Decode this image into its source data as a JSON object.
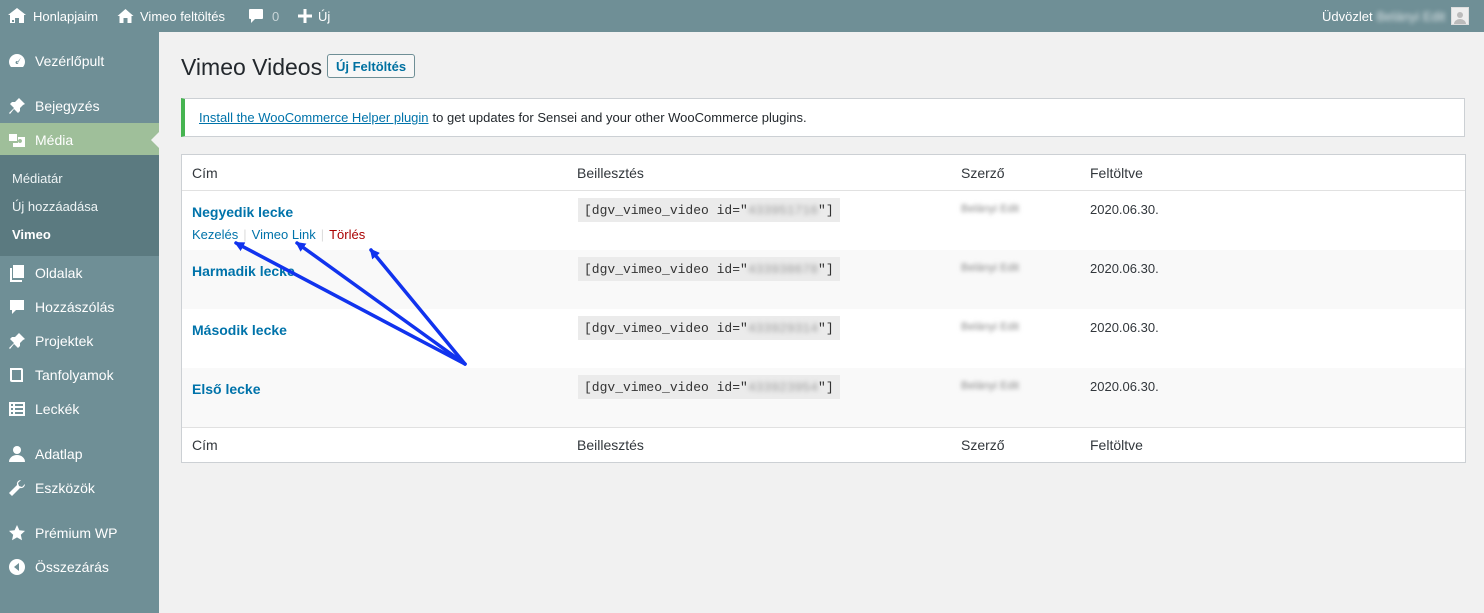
{
  "adminbar": {
    "my_sites": "Honlapjaim",
    "site_name": "Vimeo feltöltés",
    "comments_count": "0",
    "new_label": "Új",
    "greeting": "Üdvözlet",
    "user_name": "Belányi Edit"
  },
  "sidebar": {
    "items": [
      {
        "label": "Vezérlőpult",
        "icon": "dashboard-icon"
      },
      {
        "label": "Bejegyzés",
        "icon": "pin-icon"
      },
      {
        "label": "Média",
        "icon": "media-icon"
      },
      {
        "label": "Oldalak",
        "icon": "pages-icon"
      },
      {
        "label": "Hozzászólás",
        "icon": "comment-icon"
      },
      {
        "label": "Projektek",
        "icon": "pin-icon"
      },
      {
        "label": "Tanfolyamok",
        "icon": "book-icon"
      },
      {
        "label": "Leckék",
        "icon": "list-icon"
      },
      {
        "label": "Adatlap",
        "icon": "user-icon"
      },
      {
        "label": "Eszközök",
        "icon": "wrench-icon"
      },
      {
        "label": "Prémium WP",
        "icon": "star-icon"
      },
      {
        "label": "Összezárás",
        "icon": "collapse-icon"
      }
    ],
    "submenu": [
      "Médiatár",
      "Új hozzáadása",
      "Vimeo"
    ]
  },
  "main": {
    "title": "Vimeo Videos",
    "new_upload": "Új Feltöltés",
    "notice": {
      "link": "Install the WooCommerce Helper plugin",
      "text": "to get updates for Sensei and your other WooCommerce plugins."
    },
    "table": {
      "columns": [
        "Cím",
        "Beillesztés",
        "Szerző",
        "Feltöltve"
      ],
      "row_actions": [
        "Kezelés",
        "Vimeo Link",
        "Törlés"
      ],
      "rows": [
        {
          "title": "Negyedik lecke",
          "code_prefix": "[dgv_vimeo_video id=\"",
          "code_id": "433951716",
          "code_suffix": "\"]",
          "author": "Belányi Edit",
          "date": "2020.06.30."
        },
        {
          "title": "Harmadik lecke",
          "code_prefix": "[dgv_vimeo_video id=\"",
          "code_id": "433938678",
          "code_suffix": "\"]",
          "author": "Belányi Edit",
          "date": "2020.06.30."
        },
        {
          "title": "Második lecke",
          "code_prefix": "[dgv_vimeo_video id=\"",
          "code_id": "433929314",
          "code_suffix": "\"]",
          "author": "Belányi Edit",
          "date": "2020.06.30."
        },
        {
          "title": "Első lecke",
          "code_prefix": "[dgv_vimeo_video id=\"",
          "code_id": "433923954",
          "code_suffix": "\"]",
          "author": "Belányi Edit",
          "date": "2020.06.30."
        }
      ]
    }
  },
  "colors": {
    "adminbar_bg": "#6f8f96",
    "sidebar_current": "#9fbf9a",
    "link": "#0073aa",
    "delete": "#aa0000",
    "notice_border": "#46b450",
    "annotation_arrow": "#1133ee"
  }
}
